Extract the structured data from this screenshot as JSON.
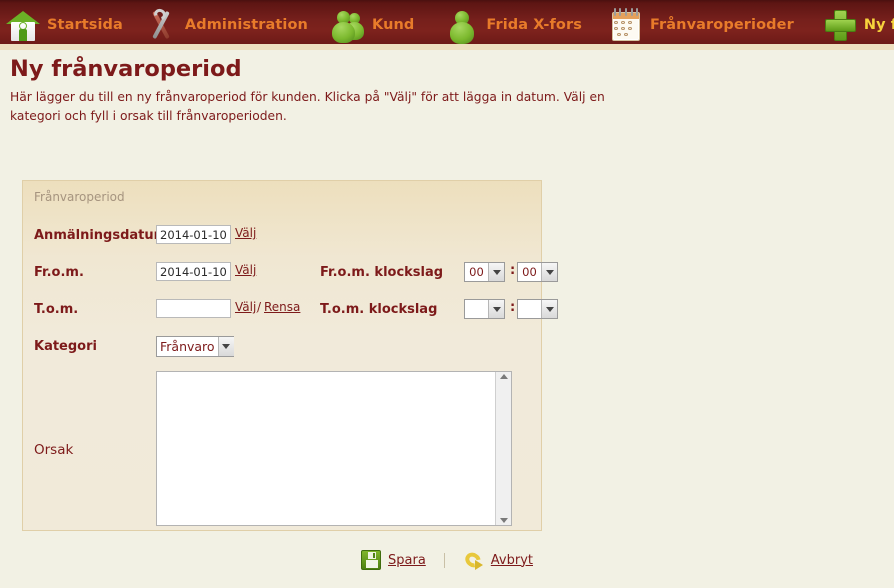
{
  "nav": {
    "items": [
      {
        "icon": "home-icon",
        "label": "Startsida",
        "active": false
      },
      {
        "icon": "tools-icon",
        "label": "Administration",
        "active": false
      },
      {
        "icon": "people-icon",
        "label": "Kund",
        "active": false
      },
      {
        "icon": "person-icon",
        "label": "Frida X-fors",
        "active": false
      },
      {
        "icon": "calendar-icon",
        "label": "Frånvaroperioder",
        "active": false
      },
      {
        "icon": "plus-icon",
        "label": "Ny frånvaroperiod",
        "active": true
      }
    ]
  },
  "header": {
    "title": "Ny frånvaroperiod",
    "description": "Här lägger du till en ny frånvaroperiod för kunden. Klicka på \"Välj\" för att lägga in datum. Välj en kategori och fyll i orsak till frånvaroperioden."
  },
  "form": {
    "legend": "Frånvaroperiod",
    "anmalningsdatum": {
      "label": "Anmälningsdatum",
      "value": "2014-01-10",
      "pick_link": "Välj"
    },
    "from": {
      "label": "Fr.o.m.",
      "value": "2014-01-10",
      "pick_link": "Välj",
      "time_label": "Fr.o.m. klockslag",
      "hour": "00",
      "minute": "00",
      "time_separator": ":"
    },
    "tom": {
      "label": "T.o.m.",
      "value": "",
      "pick_link": "Välj",
      "separator": "/",
      "clear_link": "Rensa",
      "time_label": "T.o.m. klockslag",
      "hour": "",
      "minute": "",
      "time_separator": ":"
    },
    "kategori": {
      "label": "Kategori",
      "value": "Frånvaro"
    },
    "orsak": {
      "label": "Orsak",
      "value": ""
    }
  },
  "actions": {
    "save": {
      "label": "Spara",
      "icon": "save-icon"
    },
    "cancel": {
      "label": "Avbryt",
      "icon": "undo-icon"
    }
  },
  "colors": {
    "nav_bg": "#76201c",
    "nav_text": "#e87b2a",
    "nav_text_active": "#f7d33c",
    "page_bg": "#f2f1e4",
    "panel_bg": "#f1ead9",
    "brand_dark_red": "#7d1a1a",
    "legend_gray": "#a6947f",
    "accent_green": "#6bb126"
  }
}
